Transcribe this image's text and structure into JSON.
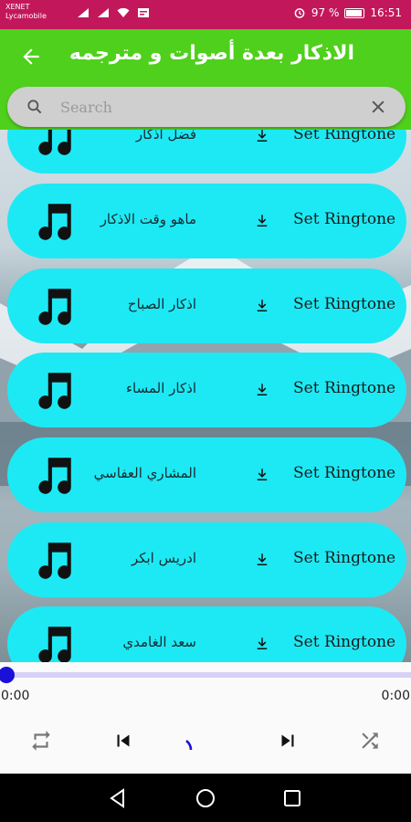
{
  "status_bar": {
    "carrier_line1": "XENET",
    "carrier_line2": "Lycamobile",
    "battery_percent": "97 %",
    "time": "16:51"
  },
  "app_bar": {
    "title": "الاذكار بعدة أصوات و مترجمه"
  },
  "search": {
    "placeholder": "Search"
  },
  "rows": [
    {
      "title": "فضل اذكار",
      "action": "Set Ringtone"
    },
    {
      "title": "ماهو وقت الاذكار",
      "action": "Set Ringtone"
    },
    {
      "title": "اذكار الصباح",
      "action": "Set Ringtone"
    },
    {
      "title": "اذكار المساء",
      "action": "Set Ringtone"
    },
    {
      "title": "المشاري العفاسي",
      "action": "Set Ringtone"
    },
    {
      "title": "ادريس ابكر",
      "action": "Set Ringtone"
    },
    {
      "title": "سعد الغامدي",
      "action": "Set Ringtone"
    }
  ],
  "player": {
    "elapsed": "0:00",
    "duration": "0:00",
    "progress": 0
  },
  "colors": {
    "status_bar": "#c2185b",
    "app_bar": "#4fd01c",
    "row_background": "#1de9f4",
    "seek_thumb": "#1a10d8"
  },
  "icons": {
    "back": "arrow-left-icon",
    "search": "search-icon",
    "clear": "close-icon",
    "row": "music-note-icon",
    "download": "download-icon",
    "repeat": "repeat-icon",
    "previous": "skip-previous-icon",
    "next": "skip-next-icon",
    "shuffle": "shuffle-icon"
  }
}
